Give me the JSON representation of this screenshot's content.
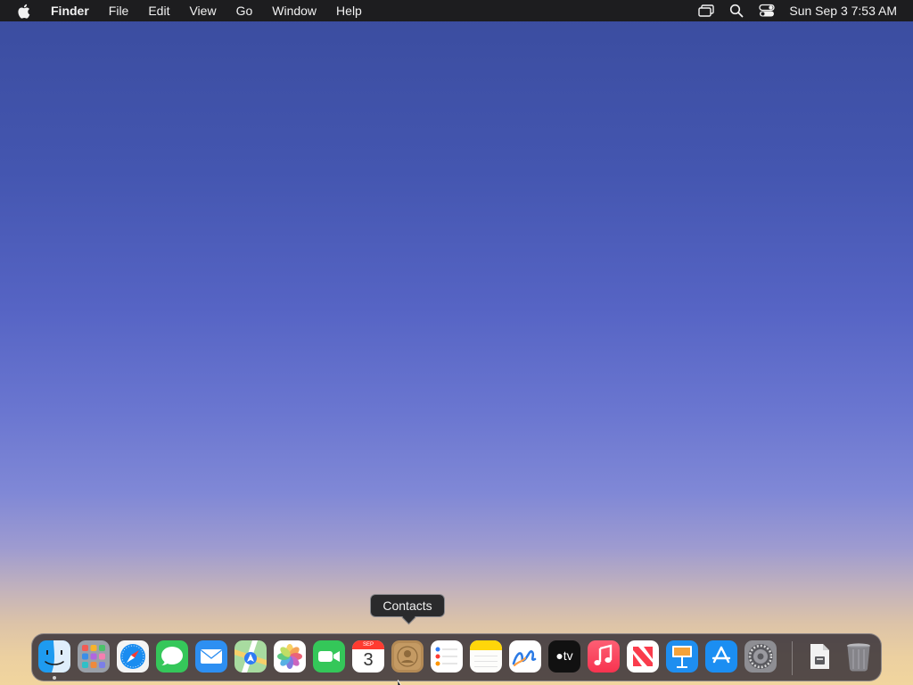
{
  "menubar": {
    "apple_icon": "apple-logo-icon",
    "app_name": "Finder",
    "items": [
      "File",
      "Edit",
      "View",
      "Go",
      "Window",
      "Help"
    ],
    "status_icons": [
      "screen-mirroring-icon",
      "spotlight-search-icon",
      "control-center-icon"
    ],
    "clock": "Sun Sep 3  7:53 AM"
  },
  "tooltip": {
    "text": "Contacts"
  },
  "dock": {
    "apps": [
      {
        "name": "Finder",
        "icon": "finder-icon",
        "running": true
      },
      {
        "name": "Launchpad",
        "icon": "launchpad-icon"
      },
      {
        "name": "Safari",
        "icon": "safari-icon"
      },
      {
        "name": "Messages",
        "icon": "messages-icon"
      },
      {
        "name": "Mail",
        "icon": "mail-icon"
      },
      {
        "name": "Maps",
        "icon": "maps-icon"
      },
      {
        "name": "Photos",
        "icon": "photos-icon"
      },
      {
        "name": "FaceTime",
        "icon": "facetime-icon"
      },
      {
        "name": "Calendar",
        "icon": "calendar-icon"
      },
      {
        "name": "Contacts",
        "icon": "contacts-icon"
      },
      {
        "name": "Reminders",
        "icon": "reminders-icon"
      },
      {
        "name": "Notes",
        "icon": "notes-icon"
      },
      {
        "name": "Freeform",
        "icon": "freeform-icon"
      },
      {
        "name": "TV",
        "icon": "apple-tv-icon"
      },
      {
        "name": "Music",
        "icon": "music-icon"
      },
      {
        "name": "News",
        "icon": "news-icon"
      },
      {
        "name": "Keynote",
        "icon": "keynote-icon"
      },
      {
        "name": "App Store",
        "icon": "app-store-icon"
      },
      {
        "name": "System Settings",
        "icon": "system-settings-icon"
      }
    ],
    "others": [
      {
        "name": "Downloads",
        "icon": "downloads-stack-icon"
      },
      {
        "name": "Trash",
        "icon": "trash-icon"
      }
    ],
    "calendar_month": "SEP",
    "calendar_day": "3",
    "tv_label": "tv"
  },
  "colors": {
    "menubar_bg": "#1d1d1f",
    "dock_bg": "#282430",
    "tooltip_bg": "#2a2a2c"
  }
}
